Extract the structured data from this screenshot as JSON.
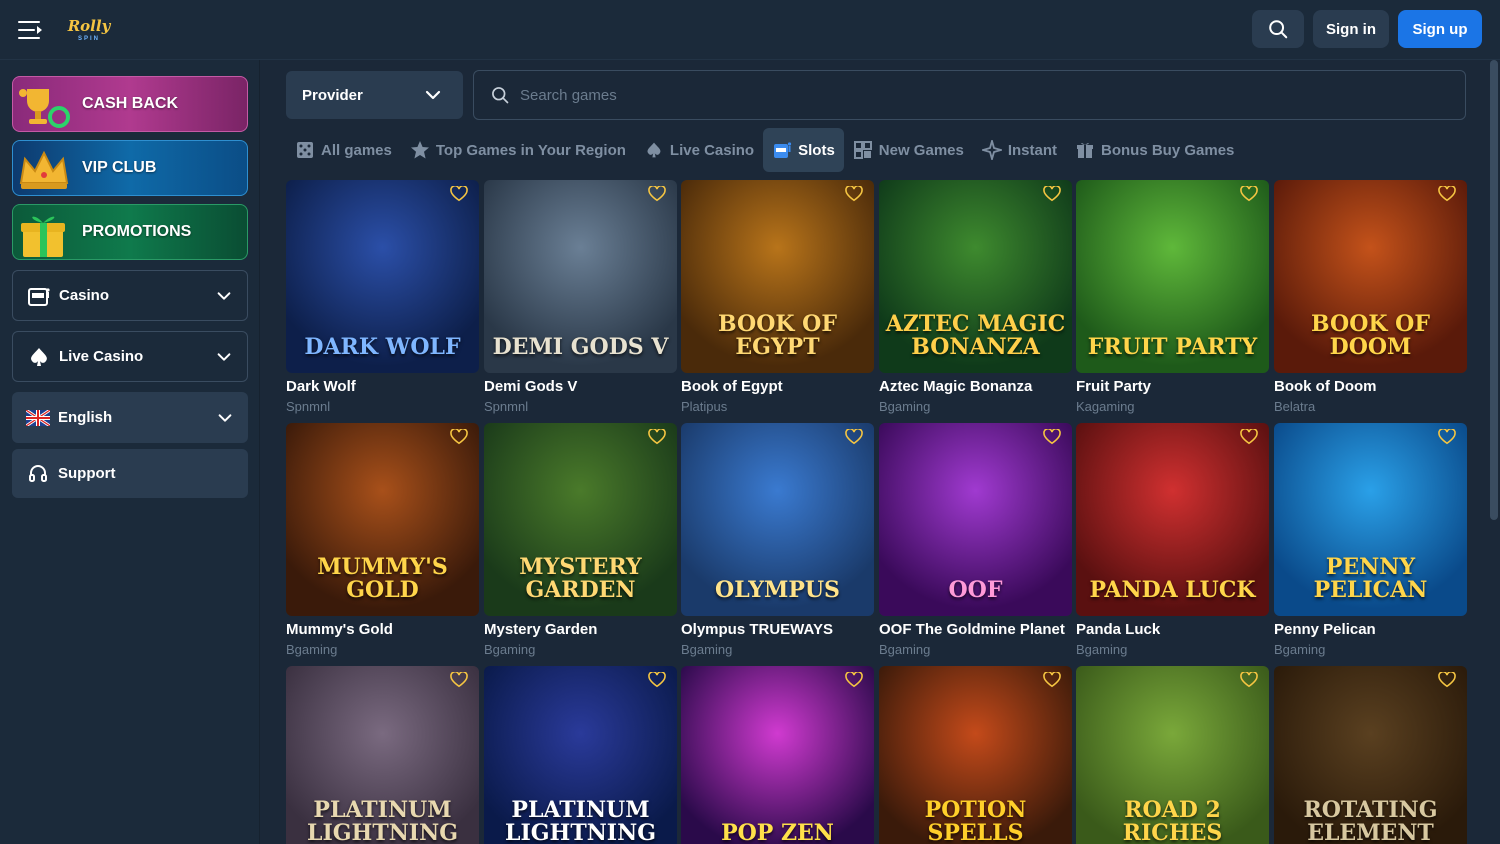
{
  "header": {
    "logo_line1": "Rolly",
    "logo_line2": "SPIN",
    "signin_label": "Sign in",
    "signup_label": "Sign up"
  },
  "sidebar": {
    "promos": [
      {
        "label": "CASH BACK"
      },
      {
        "label": "VIP CLUB"
      },
      {
        "label": "PROMOTIONS"
      }
    ],
    "items": [
      {
        "label": "Casino"
      },
      {
        "label": "Live Casino"
      },
      {
        "label": "English"
      },
      {
        "label": "Support"
      }
    ]
  },
  "filters": {
    "provider_label": "Provider",
    "search_placeholder": "Search games"
  },
  "tabs": [
    {
      "label": "All games",
      "icon": "dice-icon"
    },
    {
      "label": "Top Games in Your Region",
      "icon": "star-icon"
    },
    {
      "label": "Live Casino",
      "icon": "spade-icon"
    },
    {
      "label": "Slots",
      "icon": "slots-icon",
      "active": true
    },
    {
      "label": "New Games",
      "icon": "new-icon"
    },
    {
      "label": "Instant",
      "icon": "sparkle-icon"
    },
    {
      "label": "Bonus Buy Games",
      "icon": "gift-icon"
    }
  ],
  "games": [
    {
      "name": "Dark Wolf",
      "provider": "Spnmnl",
      "art": "DARK WOLF"
    },
    {
      "name": "Demi Gods V",
      "provider": "Spnmnl",
      "art": "DEMI GODS V"
    },
    {
      "name": "Book of Egypt",
      "provider": "Platipus",
      "art": "BOOK OF EGYPT"
    },
    {
      "name": "Aztec Magic Bonanza",
      "provider": "Bgaming",
      "art": "AZTEC MAGIC BONANZA"
    },
    {
      "name": "Fruit Party",
      "provider": "Kagaming",
      "art": "FRUIT PARTY"
    },
    {
      "name": "Book of Doom",
      "provider": "Belatra",
      "art": "BOOK OF DOOM"
    },
    {
      "name": "Mummy's Gold",
      "provider": "Bgaming",
      "art": "MUMMY'S GOLD"
    },
    {
      "name": "Mystery Garden",
      "provider": "Bgaming",
      "art": "MYSTERY GARDEN"
    },
    {
      "name": "Olympus TRUEWAYS",
      "provider": "Bgaming",
      "art": "OLYMPUS"
    },
    {
      "name": "OOF The Goldmine Planet",
      "provider": "Bgaming",
      "art": "OOF"
    },
    {
      "name": "Panda Luck",
      "provider": "Bgaming",
      "art": "PANDA LUCK"
    },
    {
      "name": "Penny Pelican",
      "provider": "Bgaming",
      "art": "PENNY PELICAN"
    },
    {
      "name": "",
      "provider": "",
      "art": "PLATINUM LIGHTNING"
    },
    {
      "name": "",
      "provider": "",
      "art": "PLATINUM LIGHTNING"
    },
    {
      "name": "",
      "provider": "",
      "art": "POP ZEN"
    },
    {
      "name": "",
      "provider": "",
      "art": "POTION SPELLS"
    },
    {
      "name": "",
      "provider": "",
      "art": "ROAD 2 RICHES"
    },
    {
      "name": "",
      "provider": "",
      "art": "ROTATING ELEMENT"
    }
  ],
  "colors": {
    "background": "#1b2838",
    "accent": "#1b75e6",
    "favorite": "#f5c542"
  }
}
